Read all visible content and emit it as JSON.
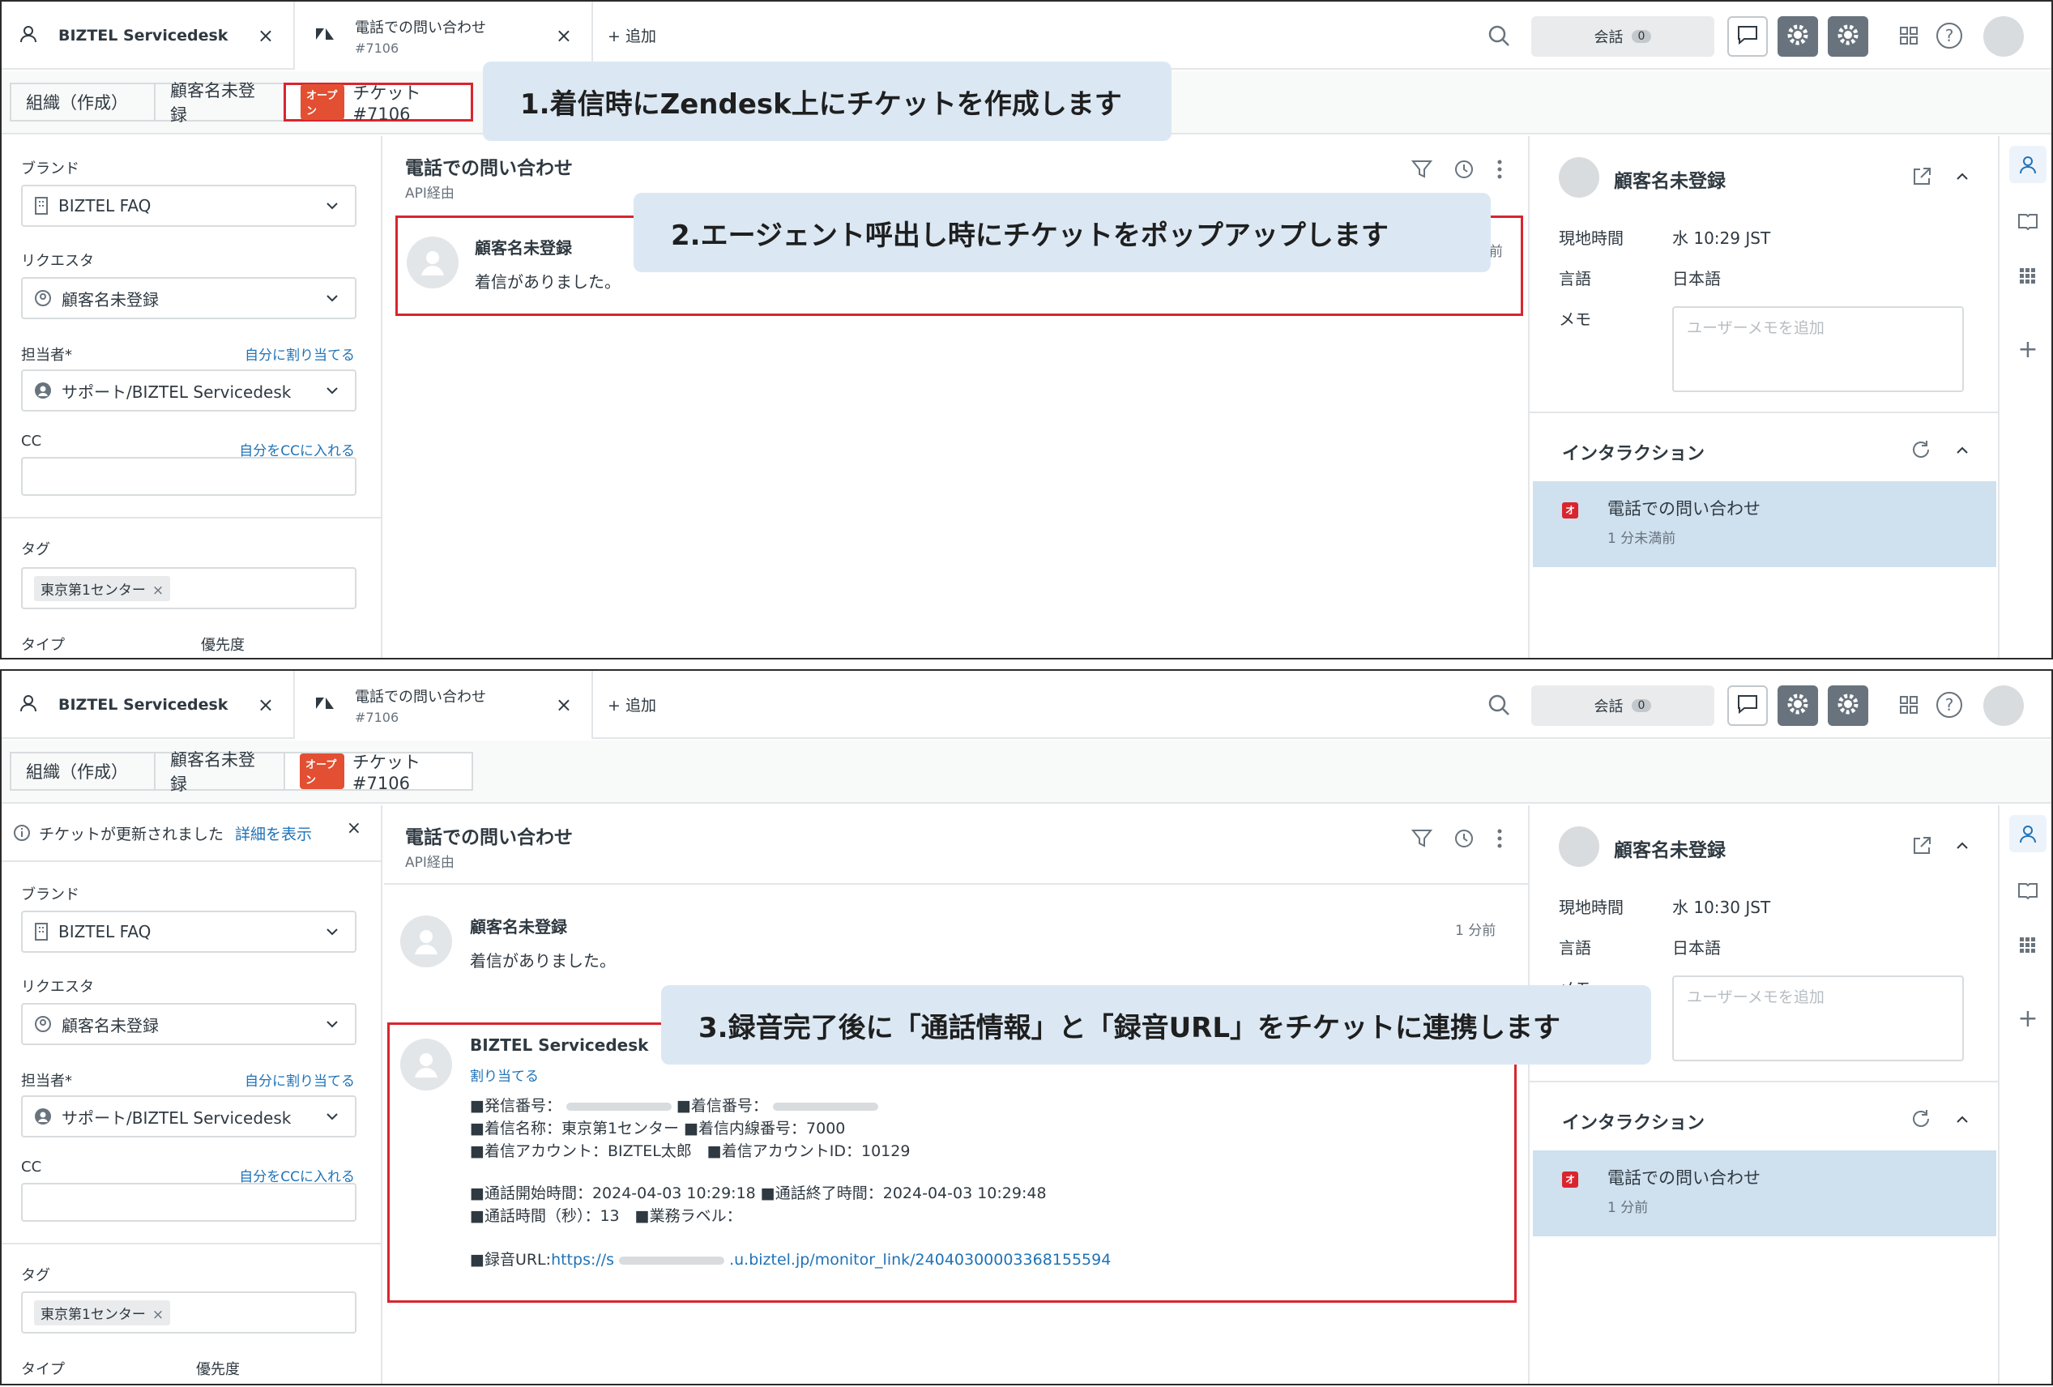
{
  "panel1": {
    "tabs": {
      "home_label": "BIZTEL Servicedesk",
      "ticket_title": "電話での問い合わせ",
      "ticket_number": "#7106",
      "add_label": "+ 追加",
      "close_glyph": "×"
    },
    "talk": {
      "label": "会話",
      "count": "0"
    },
    "subtabs": {
      "org": "組織（作成）",
      "customer": "顧客名未登録",
      "status": "オープン",
      "ticket": "チケット #7106"
    },
    "form": {
      "brand_label": "ブランド",
      "brand_value": "BIZTEL FAQ",
      "requester_label": "リクエスタ",
      "requester_value": "顧客名未登録",
      "assignee_label": "担当者*",
      "assign_self": "自分に割り当てる",
      "assignee_value": "サポート/BIZTEL Servicedesk",
      "cc_label": "CC",
      "cc_self": "自分をCCに入れる",
      "tags_label": "タグ",
      "tag_value": "東京第1センター",
      "tag_remove": "×",
      "type_label": "タイプ",
      "priority_label": "優先度"
    },
    "ticket": {
      "title": "電話での問い合わせ",
      "via": "API経由",
      "message_author": "顧客名未登録",
      "message_body": "着信がありました。",
      "message_time": "前"
    },
    "user": {
      "name": "顧客名未登録",
      "local_time_label": "現地時間",
      "local_time": "水 10:29 JST",
      "language_label": "言語",
      "language": "日本語",
      "memo_label": "メモ",
      "memo_placeholder": "ユーザーメモを追加",
      "interaction_title": "インタラクション",
      "interaction_item": "電話での問い合わせ",
      "interaction_time": "1 分未満前",
      "interaction_badge": "オ"
    },
    "callout1": "1.着信時にZendesk上にチケットを作成します",
    "callout2": "2.エージェント呼出し時にチケットをポップアップします"
  },
  "panel2": {
    "tabs": {
      "home_label": "BIZTEL Servicedesk",
      "ticket_title": "電話での問い合わせ",
      "ticket_number": "#7106",
      "add_label": "+ 追加",
      "close_glyph": "×"
    },
    "talk": {
      "label": "会話",
      "count": "0"
    },
    "subtabs": {
      "org": "組織（作成）",
      "customer": "顧客名未登録",
      "status": "オープン",
      "ticket": "チケット #7106"
    },
    "notice": {
      "text": "チケットが更新されました",
      "link": "詳細を表示",
      "close": "×"
    },
    "form": {
      "brand_label": "ブランド",
      "brand_value": "BIZTEL FAQ",
      "requester_label": "リクエスタ",
      "requester_value": "顧客名未登録",
      "assignee_label": "担当者*",
      "assign_self": "自分に割り当てる",
      "assignee_value": "サポート/BIZTEL Servicedesk",
      "cc_label": "CC",
      "cc_self": "自分をCCに入れる",
      "tags_label": "タグ",
      "tag_value": "東京第1センター",
      "tag_remove": "×",
      "type_label": "タイプ",
      "priority_label": "優先度"
    },
    "ticket": {
      "title": "電話での問い合わせ",
      "via": "API経由",
      "message_author": "顧客名未登録",
      "message_body": "着信がありました。",
      "message_time": "1 分前",
      "system_author": "BIZTEL Servicedesk",
      "system_assign": "割り当てる",
      "line1_a": "■発信番号：",
      "line1_b": "■着信番号：",
      "line2": "■着信名称：東京第1センター ■着信内線番号：7000",
      "line3": "■着信アカウント：BIZTEL太郎　■着信アカウントID：10129",
      "line4": "■通話開始時間：2024-04-03 10:29:18 ■通話終了時間：2024-04-03 10:29:48",
      "line5": "■通話時間（秒）：13　■業務ラベル：",
      "url_label": "■録音URL:",
      "url_prefix": "https://s",
      "url_suffix": ".u.biztel.jp/monitor_link/24040300003368155594"
    },
    "user": {
      "name": "顧客名未登録",
      "local_time_label": "現地時間",
      "local_time": "水 10:30 JST",
      "language_label": "言語",
      "language": "日本語",
      "memo_label": "メモ",
      "memo_placeholder": "ユーザーメモを追加",
      "interaction_title": "インタラクション",
      "interaction_item": "電話での問い合わせ",
      "interaction_time": "1 分前",
      "interaction_badge": "オ"
    },
    "callout3": "3.録音完了後に「通話情報」と「録音URL」をチケットに連携します"
  }
}
